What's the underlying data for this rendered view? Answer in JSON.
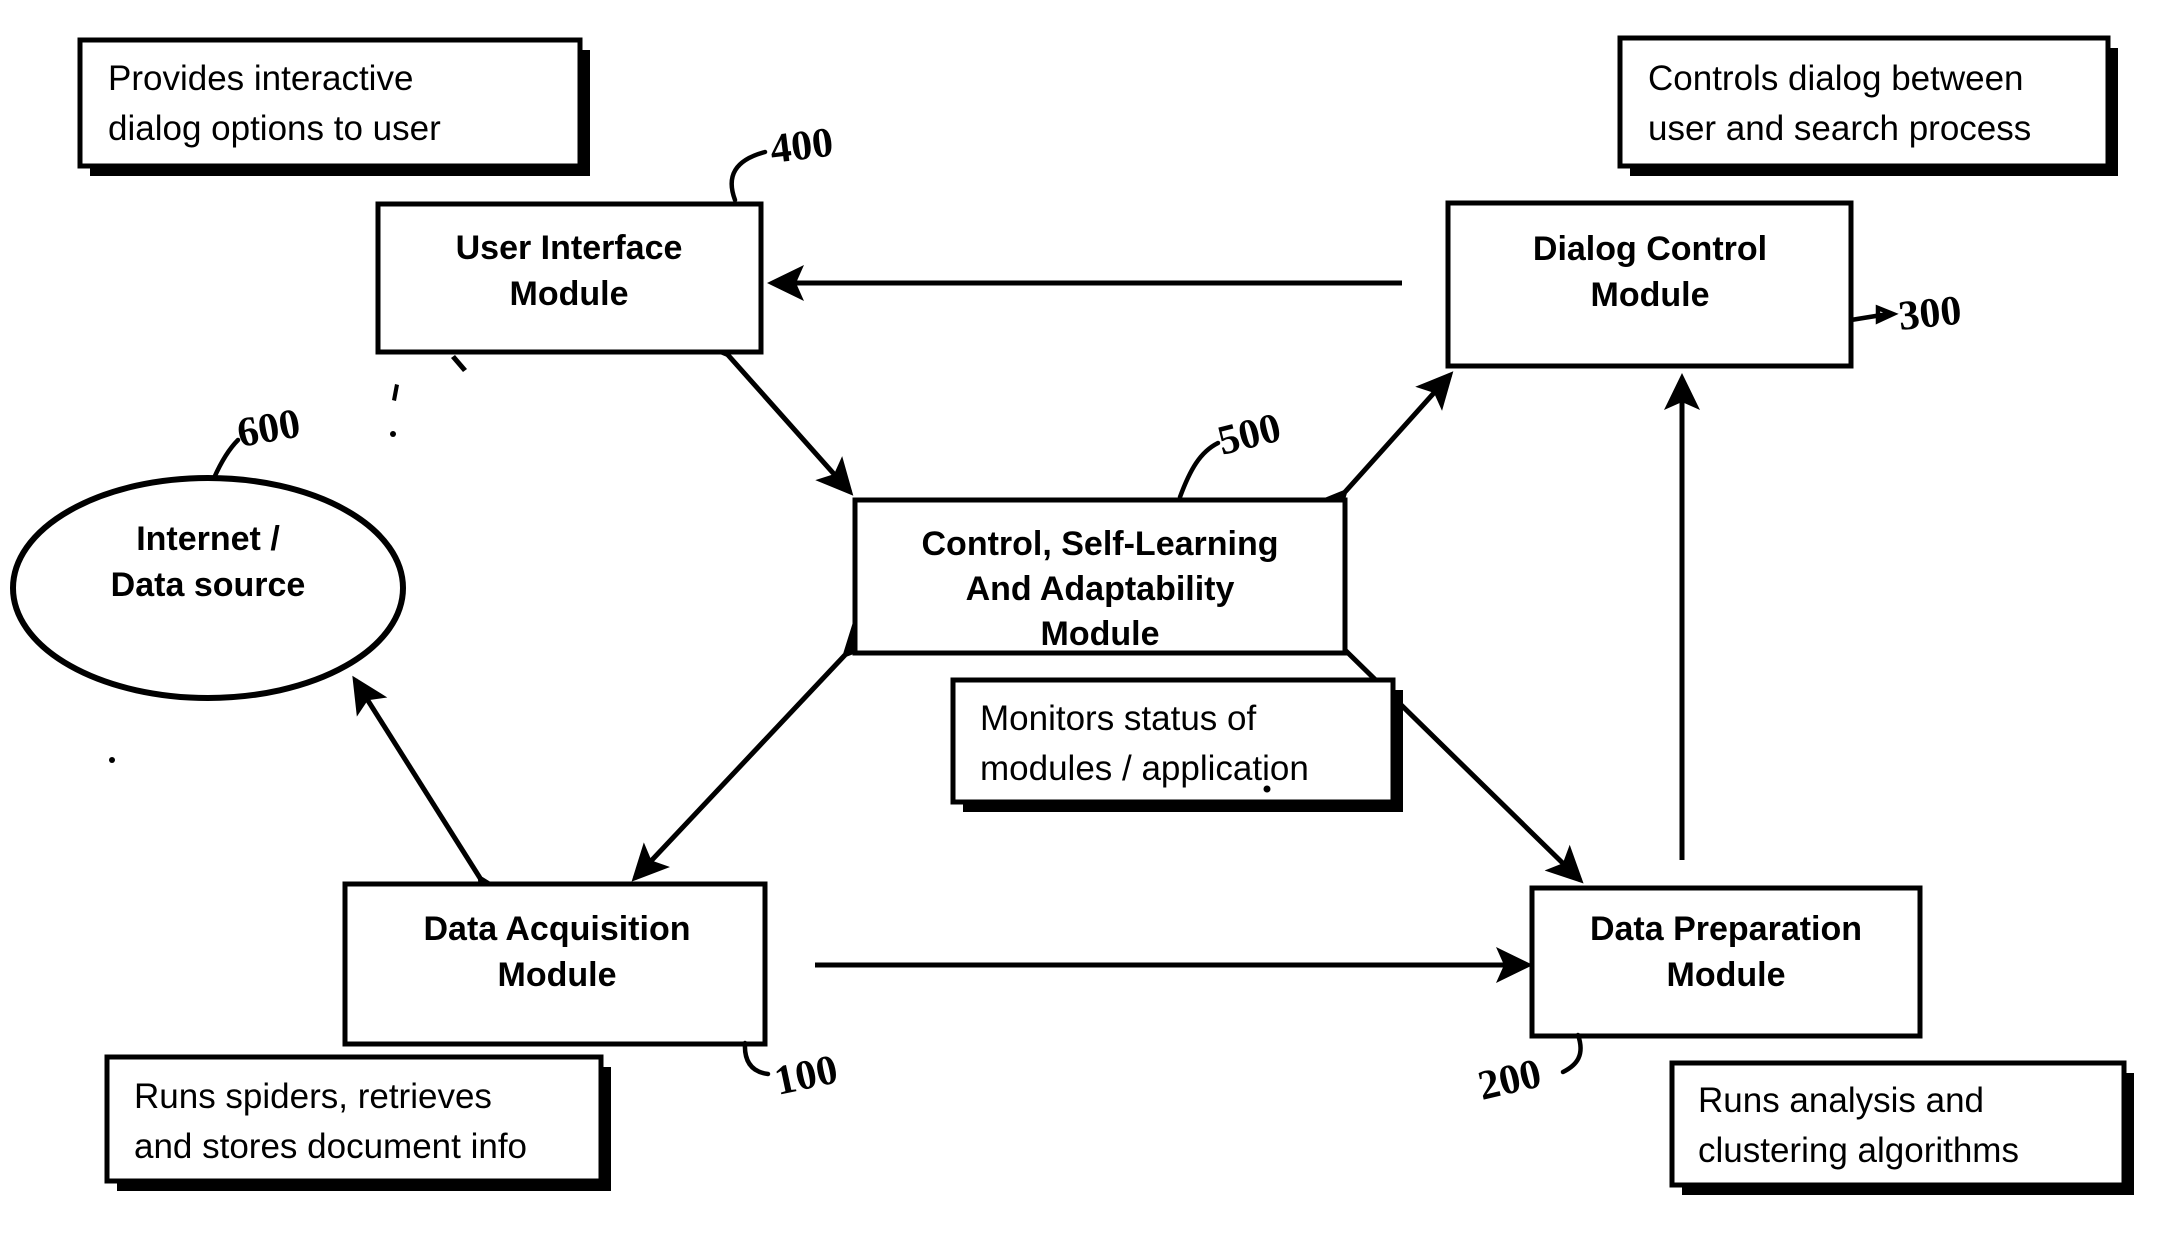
{
  "diagram": {
    "title": "System architecture block diagram",
    "background_color": "#ffffff",
    "line_color": "#000000",
    "nodes": [
      {
        "id": "user_interface",
        "shape": "rectangle",
        "label_line1": "User Interface",
        "label_line2": "Module",
        "ref": "400"
      },
      {
        "id": "dialog_control",
        "shape": "rectangle",
        "label_line1": "Dialog Control",
        "label_line2": "Module",
        "ref": "300"
      },
      {
        "id": "control_module",
        "shape": "rectangle",
        "label_line1": "Control, Self-Learning",
        "label_line2": "And Adaptability",
        "label_line3": "Module",
        "ref": "500"
      },
      {
        "id": "internet_source",
        "shape": "ellipse",
        "label_line1": "Internet /",
        "label_line2": "Data source",
        "ref": "600"
      },
      {
        "id": "data_acquisition",
        "shape": "rectangle",
        "label_line1": "Data Acquisition",
        "label_line2": "Module",
        "ref": "100"
      },
      {
        "id": "data_preparation",
        "shape": "rectangle",
        "label_line1": "Data Preparation",
        "label_line2": "Module",
        "ref": "200"
      }
    ],
    "notes": [
      {
        "id": "note_ui",
        "line1": "Provides interactive",
        "line2": "dialog options to user"
      },
      {
        "id": "note_dialog",
        "line1": "Controls dialog between",
        "line2": "user and search process"
      },
      {
        "id": "note_control",
        "line1": "Monitors status of",
        "line2": "modules / application"
      },
      {
        "id": "note_acquisition",
        "line1": "Runs spiders, retrieves",
        "line2": "and stores document info"
      },
      {
        "id": "note_preparation",
        "line1": "Runs analysis and",
        "line2": "clustering algorithms"
      }
    ],
    "connections": [
      {
        "id": "dialog-to-ui",
        "from": "dialog_control",
        "to": "user_interface",
        "arrow": "single"
      },
      {
        "id": "ui-to-control",
        "from": "user_interface",
        "to": "control_module",
        "arrow": "double"
      },
      {
        "id": "control-to-dialog",
        "from": "control_module",
        "to": "dialog_control",
        "arrow": "double"
      },
      {
        "id": "control-to-acquisition",
        "from": "control_module",
        "to": "data_acquisition",
        "arrow": "double"
      },
      {
        "id": "control-to-preparation",
        "from": "control_module",
        "to": "data_preparation",
        "arrow": "double"
      },
      {
        "id": "acquisition-to-internet",
        "from": "data_acquisition",
        "to": "internet_source",
        "arrow": "double"
      },
      {
        "id": "acquisition-to-preparation",
        "from": "data_acquisition",
        "to": "data_preparation",
        "arrow": "single"
      },
      {
        "id": "preparation-to-dialog",
        "from": "data_preparation",
        "to": "dialog_control",
        "arrow": "single"
      }
    ]
  }
}
